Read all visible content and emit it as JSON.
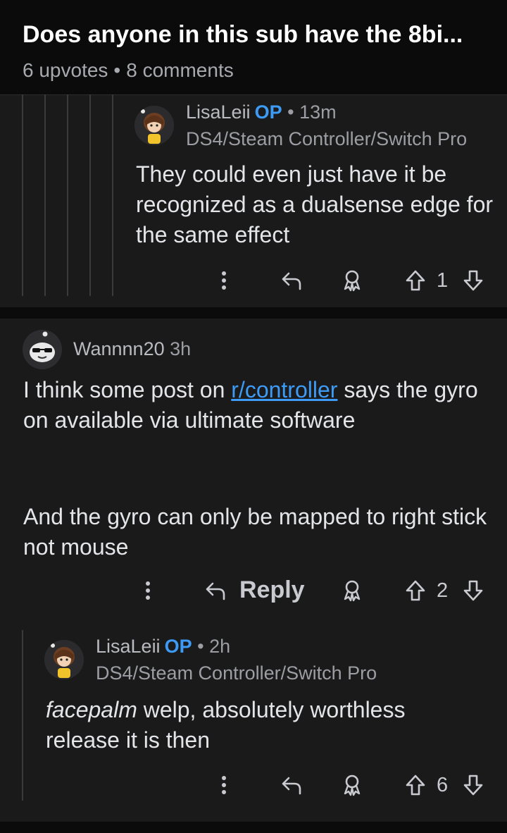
{
  "header": {
    "title": "Does anyone in this sub have the 8bi...",
    "upvotes": "6 upvotes",
    "separator": "•",
    "comments": "8 comments"
  },
  "comments": [
    {
      "author": "LisaLeii",
      "op_badge": "OP",
      "separator": "•",
      "time": "13m",
      "flair": "DS4/Steam Controller/Switch Pro",
      "body": "They could even just have it be recognized as a dualsense edge for the same effect",
      "votes": "1"
    },
    {
      "author": "Wannnn20",
      "time": "3h",
      "body_prefix": "I think some post on ",
      "body_link": "r/controller",
      "body_suffix": " says the gyro on available via ultimate software",
      "body_para2": "And the gyro can only be mapped to right stick not mouse",
      "reply_label": "Reply",
      "votes": "2"
    },
    {
      "author": "LisaLeii",
      "op_badge": "OP",
      "separator": "•",
      "time": "2h",
      "flair": "DS4/Steam Controller/Switch Pro",
      "body_italic": "facepalm",
      "body_rest": " welp, absolutely worthless release it is then",
      "votes": "6"
    }
  ],
  "colors": {
    "background": "#1a1a1b",
    "header_bg": "#0b0b0c",
    "link": "#3d9bf5",
    "op_badge": "#3d9bf5",
    "text": "#e4e5e8",
    "muted": "#9c9ea4"
  },
  "icons": [
    "more-vertical-icon",
    "reply-arrow-icon",
    "award-icon",
    "upvote-arrow-icon",
    "downvote-arrow-icon",
    "snoo-avatar-icon"
  ]
}
